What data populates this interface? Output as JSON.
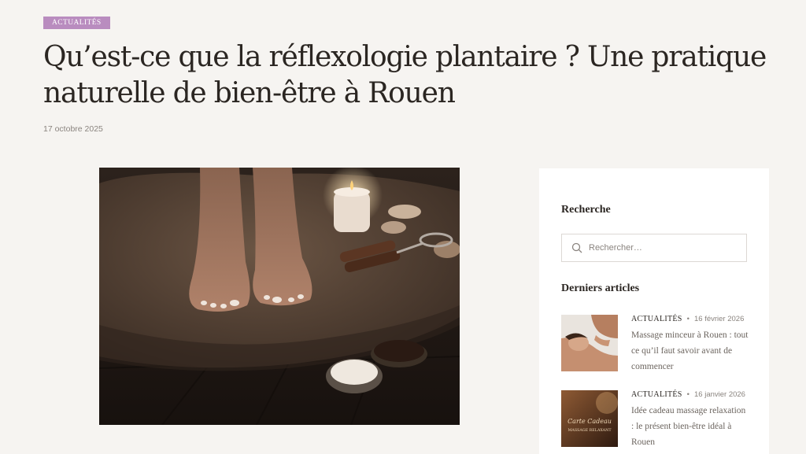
{
  "article": {
    "category": "ACTUALITÉS",
    "title": "Qu’est-ce que la réflexologie plantaire ? Une pratique naturelle de bien-être à Rouen",
    "date": "17 octobre 2025"
  },
  "sidebar": {
    "search_heading": "Recherche",
    "search_placeholder": "Rechercher…",
    "recent_heading": "Derniers articles",
    "posts": [
      {
        "category": "ACTUALITÉS",
        "separator": "•",
        "date": "16 février 2026",
        "title": "Massage minceur à Rouen : tout ce qu’il faut savoir avant de commencer"
      },
      {
        "category": "ACTUALITÉS",
        "separator": "•",
        "date": "16 janvier 2026",
        "title": "Idée cadeau massage relaxation : le présent bien-être idéal à Rouen",
        "image_text": [
          "Carte Cadeau",
          "MASSAGE RELAXANT"
        ]
      }
    ]
  },
  "colors": {
    "background": "#f6f4f1",
    "badge": "#b98cbf",
    "heading": "#2b2622",
    "muted": "#8a847f"
  }
}
